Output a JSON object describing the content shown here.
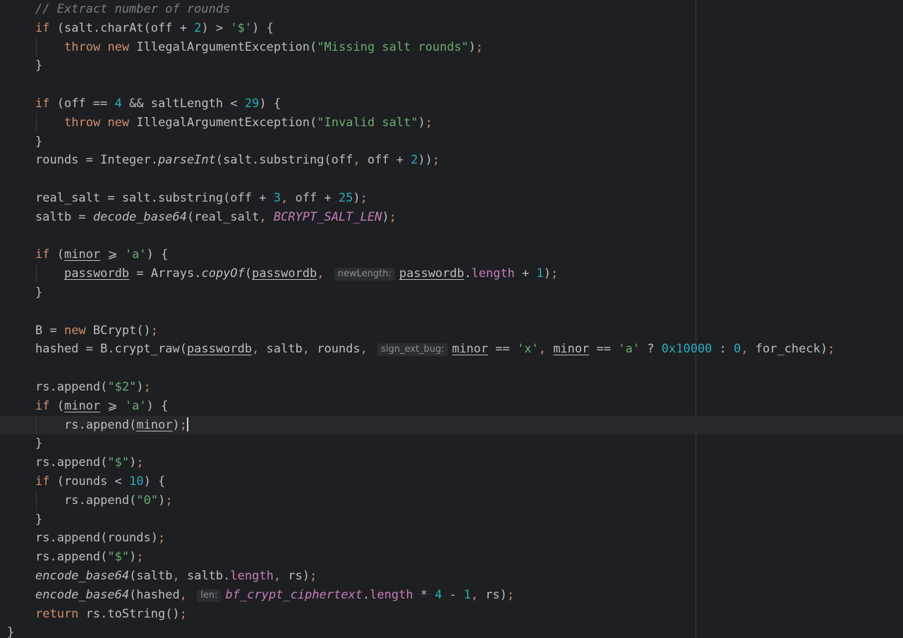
{
  "editor": {
    "lines": [
      "// Extract number of rounds",
      "if (salt.charAt(off + 2) > '$') {",
      "throw new IllegalArgumentException(\"Missing salt rounds\");",
      "}",
      "",
      "if (off == 4 && saltLength < 29) {",
      "throw new IllegalArgumentException(\"Invalid salt\");",
      "}",
      "rounds = Integer.parseInt(salt.substring(off, off + 2));",
      "",
      "real_salt = salt.substring(off + 3, off + 25);",
      "saltb = decode_base64(real_salt, BCRYPT_SALT_LEN);",
      "",
      "if (minor >= 'a') {",
      "passwordb = Arrays.copyOf(passwordb, passwordb.length + 1);",
      "}",
      "",
      "B = new BCrypt();",
      "hashed = B.crypt_raw(passwordb, saltb, rounds, minor == 'x', minor == 'a' ? 0x10000 : 0, for_check);",
      "",
      "rs.append(\"$2\");",
      "if (minor >= 'a') {",
      "rs.append(minor);",
      "}",
      "rs.append(\"$\");",
      "if (rounds < 10) {",
      "rs.append(\"0\");",
      "}",
      "rs.append(rounds);",
      "rs.append(\"$\");",
      "encode_base64(saltb, saltb.length, rs);",
      "encode_base64(hashed, bf_crypt_ciphertext.length * 4 - 1, rs);",
      "return rs.toString();",
      "}"
    ],
    "inlay_hints": {
      "new_length": "newLength:",
      "sign_ext_bug": "sign_ext_bug:",
      "len": "len:"
    },
    "caret_line": 23,
    "colors": {
      "background": "#1e1f22",
      "keyword": "#cf8e6d",
      "string": "#6aab73",
      "number": "#2aacb8",
      "comment": "#7a7e85",
      "field": "#c77dbb",
      "text": "#bcbec4"
    }
  }
}
